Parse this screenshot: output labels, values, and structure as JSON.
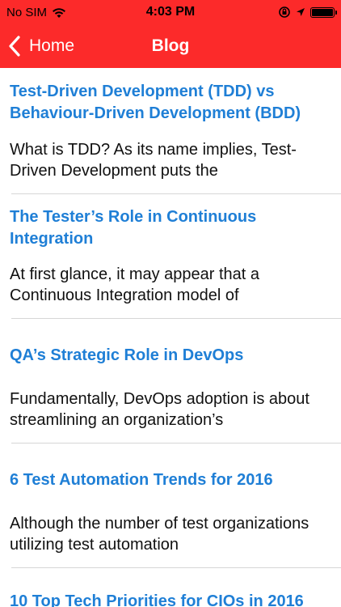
{
  "status_bar": {
    "carrier": "No SIM",
    "time": "4:03 PM"
  },
  "nav": {
    "back_label": "Home",
    "title": "Blog"
  },
  "theme": {
    "accent": "#fc2a2a",
    "link": "#1f7fd6"
  },
  "posts": [
    {
      "title": "Test-Driven Development (TDD) vs Behaviour-Driven Development (BDD)",
      "excerpt": "What is TDD? As its name implies, Test-Driven Development puts the"
    },
    {
      "title": "The Tester’s Role in Continuous Integration",
      "excerpt": "At first glance, it may appear that a Continuous Integration model of"
    },
    {
      "title": "QA’s Strategic Role in DevOps",
      "excerpt": "Fundamentally, DevOps adoption is about streamlining an organization’s"
    },
    {
      "title": "6 Test Automation Trends for 2016",
      "excerpt": "Although the number of test organizations utilizing test automation"
    },
    {
      "title": "10 Top Tech Priorities for CIOs in 2016",
      "excerpt": ""
    }
  ]
}
